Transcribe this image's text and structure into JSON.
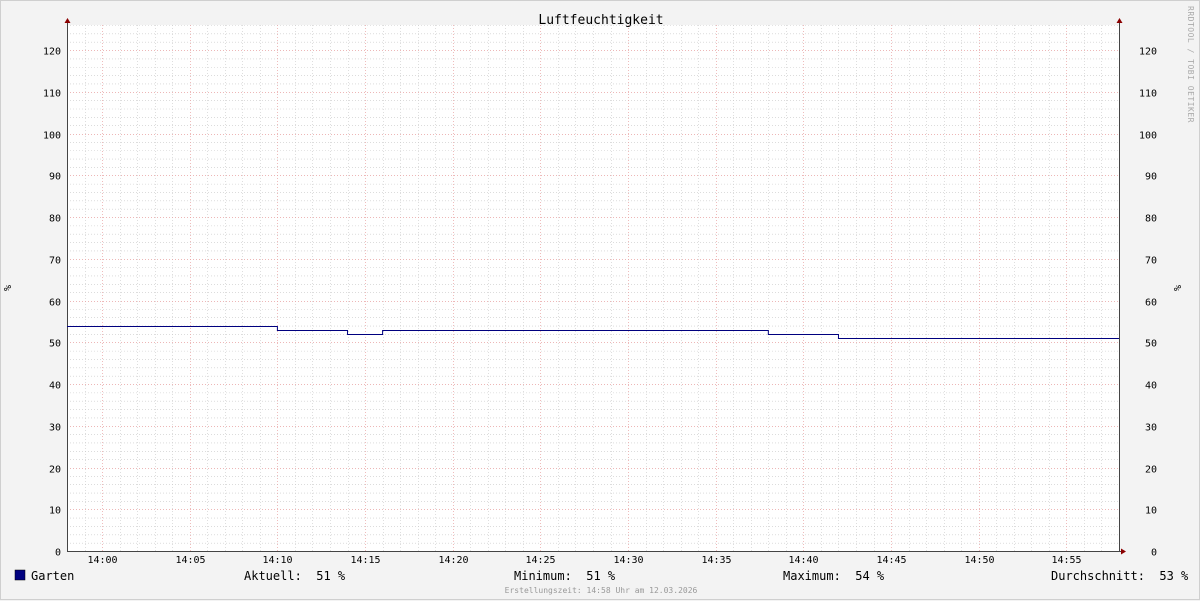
{
  "chart_data": {
    "type": "line",
    "title": "Luftfeuchtigkeit",
    "ylabel": "%",
    "ylim": [
      0,
      126
    ],
    "y_ticks": [
      0,
      10,
      20,
      30,
      40,
      50,
      60,
      70,
      80,
      90,
      100,
      110,
      120
    ],
    "x_ticks": [
      "14:00",
      "14:05",
      "14:10",
      "14:15",
      "14:20",
      "14:25",
      "14:30",
      "14:35",
      "14:40",
      "14:45",
      "14:50",
      "14:55"
    ],
    "grid": true,
    "legend_placement": "bottom",
    "series": [
      {
        "name": "Garten",
        "color": "#00007f",
        "step": true,
        "x": [
          "13:58",
          "14:10",
          "14:14",
          "14:16",
          "14:38",
          "14:42",
          "14:58"
        ],
        "values": [
          54,
          53,
          52,
          53,
          52,
          51,
          51
        ]
      }
    ]
  },
  "legend": {
    "series_name": "Garten",
    "swatch_color": "#00007f",
    "aktuell": "Aktuell:  51 %",
    "minimum": "Minimum:  51 %",
    "maximum": "Maximum:  54 %",
    "durchschnitt": "Durchschnitt:  53 %"
  },
  "watermark": "RRDTOOL / TOBI OETIKER",
  "footer": "Erstellungszeit: 14:58 Uhr am 12.03.2026",
  "colors": {
    "background": "#f3f3f3",
    "plot_background": "#ffffff",
    "major_grid": "#e8a0a0",
    "minor_grid": "#c8c8c8",
    "axis": "#444444",
    "arrow": "#8b0000"
  }
}
